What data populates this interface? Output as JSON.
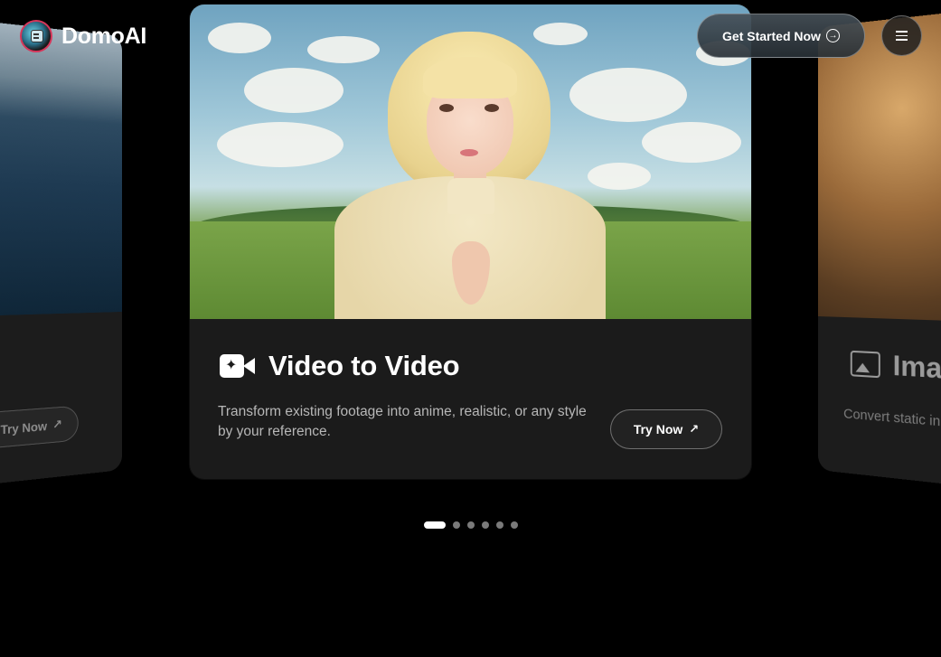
{
  "brand": {
    "name": "DomoAI"
  },
  "header": {
    "cta_label": "Get Started Now",
    "cta_icon": "arrow-circle-right-icon",
    "menu_icon": "hamburger-menu-icon"
  },
  "carousel": {
    "active_index": 0,
    "slides_total": 6,
    "center_card": {
      "icon": "video-camera-sparkle-icon",
      "title": "Video to Video",
      "description": "Transform existing footage into anime, realistic, or any style by your reference.",
      "button_label": "Try Now",
      "button_icon": "arrow-up-right-icon"
    },
    "left_card": {
      "button_label": "Try Now",
      "button_icon": "arrow-up-right-icon"
    },
    "right_card": {
      "icon": "image-icon",
      "title_partial": "Ima",
      "description_partial": "Convert static in motion."
    }
  },
  "colors": {
    "background": "#000000",
    "card": "#1b1b1b",
    "description_text": "#b7b7b7",
    "dot_inactive": "#7a7a7a",
    "dot_active": "#ffffff"
  }
}
